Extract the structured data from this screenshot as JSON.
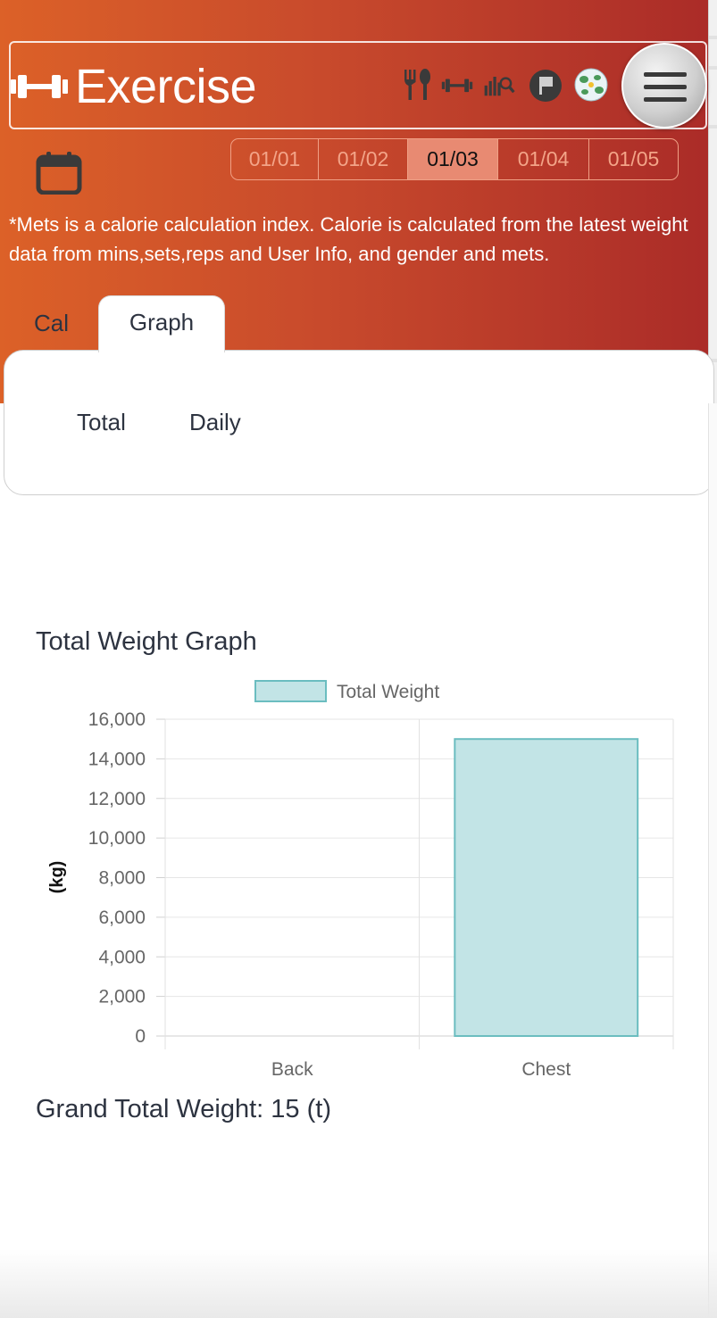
{
  "header": {
    "title": "Exercise",
    "icons": [
      "dumbbell-icon",
      "meal-icon",
      "exercise-icon",
      "stats-icon",
      "flag-icon",
      "globe-icon"
    ],
    "menu_icon": "hamburger-menu-icon"
  },
  "calendar": {
    "icon": "calendar-icon"
  },
  "date_tabs": [
    {
      "label": "01/01",
      "active": false
    },
    {
      "label": "01/02",
      "active": false
    },
    {
      "label": "01/03",
      "active": true
    },
    {
      "label": "01/04",
      "active": false
    },
    {
      "label": "01/05",
      "active": false
    }
  ],
  "note": "*Mets is a calorie calculation index. Calorie is calculated from the latest weight data from mins,sets,reps and User Info, and gender and mets.",
  "tabs": [
    {
      "label": "Cal",
      "active": false
    },
    {
      "label": "Graph",
      "active": true
    }
  ],
  "sub_tabs": {
    "total": "Total",
    "daily": "Daily"
  },
  "chart_heading": "Total Weight Graph",
  "chart_data": {
    "type": "bar",
    "categories": [
      "Back",
      "Chest"
    ],
    "series": [
      {
        "name": "Total Weight",
        "values": [
          0,
          15000
        ]
      }
    ],
    "ylabel": "(kg)",
    "ylim": [
      0,
      16000
    ],
    "yticks": [
      0,
      2000,
      4000,
      6000,
      8000,
      10000,
      12000,
      14000,
      16000
    ],
    "ytick_labels": [
      "0",
      "2,000",
      "4,000",
      "6,000",
      "8,000",
      "10,000",
      "12,000",
      "14,000",
      "16,000"
    ],
    "legend_position": "top-center",
    "grid": true,
    "colors": {
      "fill": "#c2e4e6",
      "stroke": "#6bbdc0"
    }
  },
  "grand_total": "Grand Total Weight: 15 (t)",
  "colors": {
    "accent_start": "#dc6128",
    "accent_end": "#aa2b28",
    "text": "#2d3340"
  }
}
